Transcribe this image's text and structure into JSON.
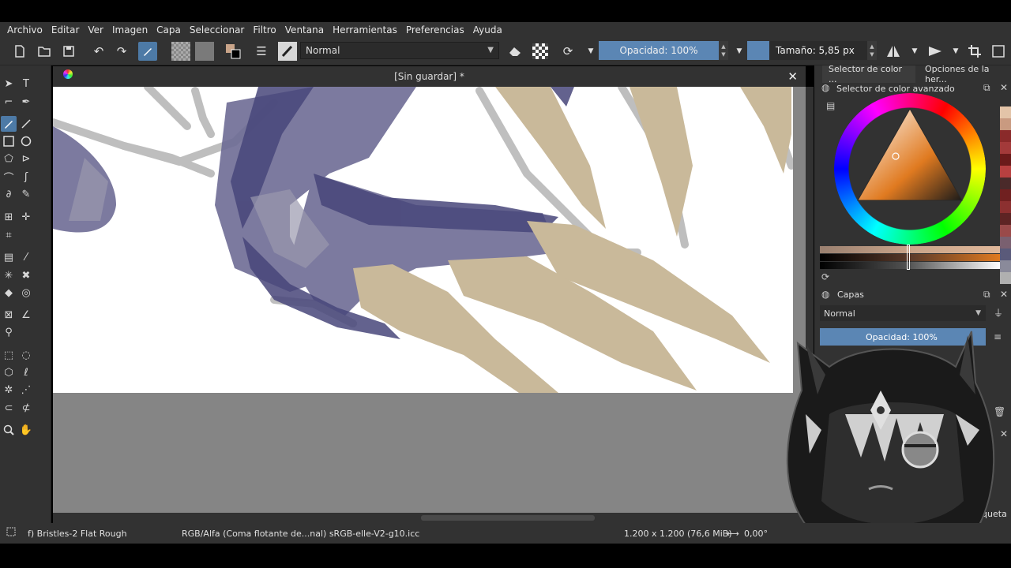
{
  "menu": [
    "Archivo",
    "Editar",
    "Ver",
    "Imagen",
    "Capa",
    "Seleccionar",
    "Filtro",
    "Ventana",
    "Herramientas",
    "Preferencias",
    "Ayuda"
  ],
  "toolbar": {
    "blend_mode": "Normal",
    "opacity_label": "Opacidad: 100%",
    "opacity_value": 1.0,
    "size_label": "Tamaño: 5,85 px"
  },
  "document": {
    "title": "[Sin guardar]",
    "modified_marker": "*"
  },
  "dock": {
    "tabs": [
      "Selector de color ...",
      "Opciones de la her..."
    ],
    "color_panel_title": "Selector de color avanzado",
    "layers_title": "Capas",
    "layers_blend": "Normal",
    "layers_opacity": "Opacidad:  100%",
    "partial_label": "iqueta"
  },
  "status": {
    "brush": "f) Bristles-2 Flat Rough",
    "color_space": "RGB/Alfa (Coma flotante de...nal)  sRGB-elle-V2-g10.icc",
    "dimensions": "1.200 x 1.200 (76,6 MiB)",
    "rotation": "0,00°"
  },
  "colors": {
    "panel": "#323232",
    "accent": "#5b86b4",
    "canvas_bg": "#858585",
    "claw": "#c9b99a",
    "purple": "#5d5a86"
  },
  "palette": [
    "#e3c4a8",
    "#c99a80",
    "#8a2a2a",
    "#a33a3a",
    "#6b1a1a",
    "#b84040",
    "#4a2a2a",
    "#702020",
    "#8c3030",
    "#5e2424",
    "#9a4a4a",
    "#7a6070",
    "#5a5a7a",
    "#8a8a9a",
    "#b0b0b0"
  ]
}
